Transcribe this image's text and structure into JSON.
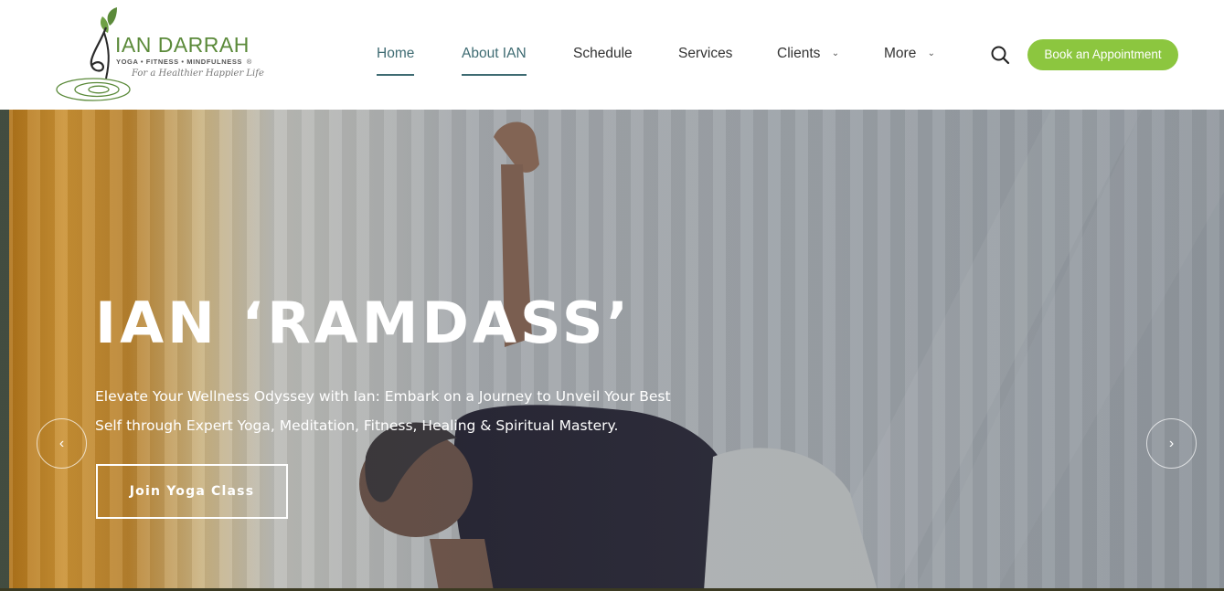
{
  "brand": {
    "name": "IAN DARRAH",
    "trademark": "®",
    "tagline": "YOGA • FITNESS • MINDFULNESS",
    "slogan": "For a Healthier Happier Life",
    "primary_color": "#5b8a3a"
  },
  "nav": {
    "items": [
      {
        "label": "Home",
        "active": true,
        "has_dropdown": false
      },
      {
        "label": "About IAN",
        "active": true,
        "has_dropdown": false
      },
      {
        "label": "Schedule",
        "active": false,
        "has_dropdown": false
      },
      {
        "label": "Services",
        "active": false,
        "has_dropdown": false
      },
      {
        "label": "Clients",
        "active": false,
        "has_dropdown": true
      },
      {
        "label": "More",
        "active": false,
        "has_dropdown": true
      }
    ],
    "dropdown_icon": "chevron-down-icon",
    "search_icon": "search-icon",
    "book_label": "Book an Appointment",
    "accent_color": "#8cc63f",
    "active_color": "#3e6b72"
  },
  "hero": {
    "title": "IAN ‘RAMDASS’",
    "subtitle_line1": "Elevate Your Wellness Odyssey with Ian: Embark on a Journey to Unveil Your Best",
    "subtitle_line2": "Self through Expert Yoga, Meditation, Fitness, Healing & Spiritual Mastery.",
    "cta_label": "Join Yoga Class",
    "prev_icon": "chevron-left-icon",
    "next_icon": "chevron-right-icon"
  }
}
